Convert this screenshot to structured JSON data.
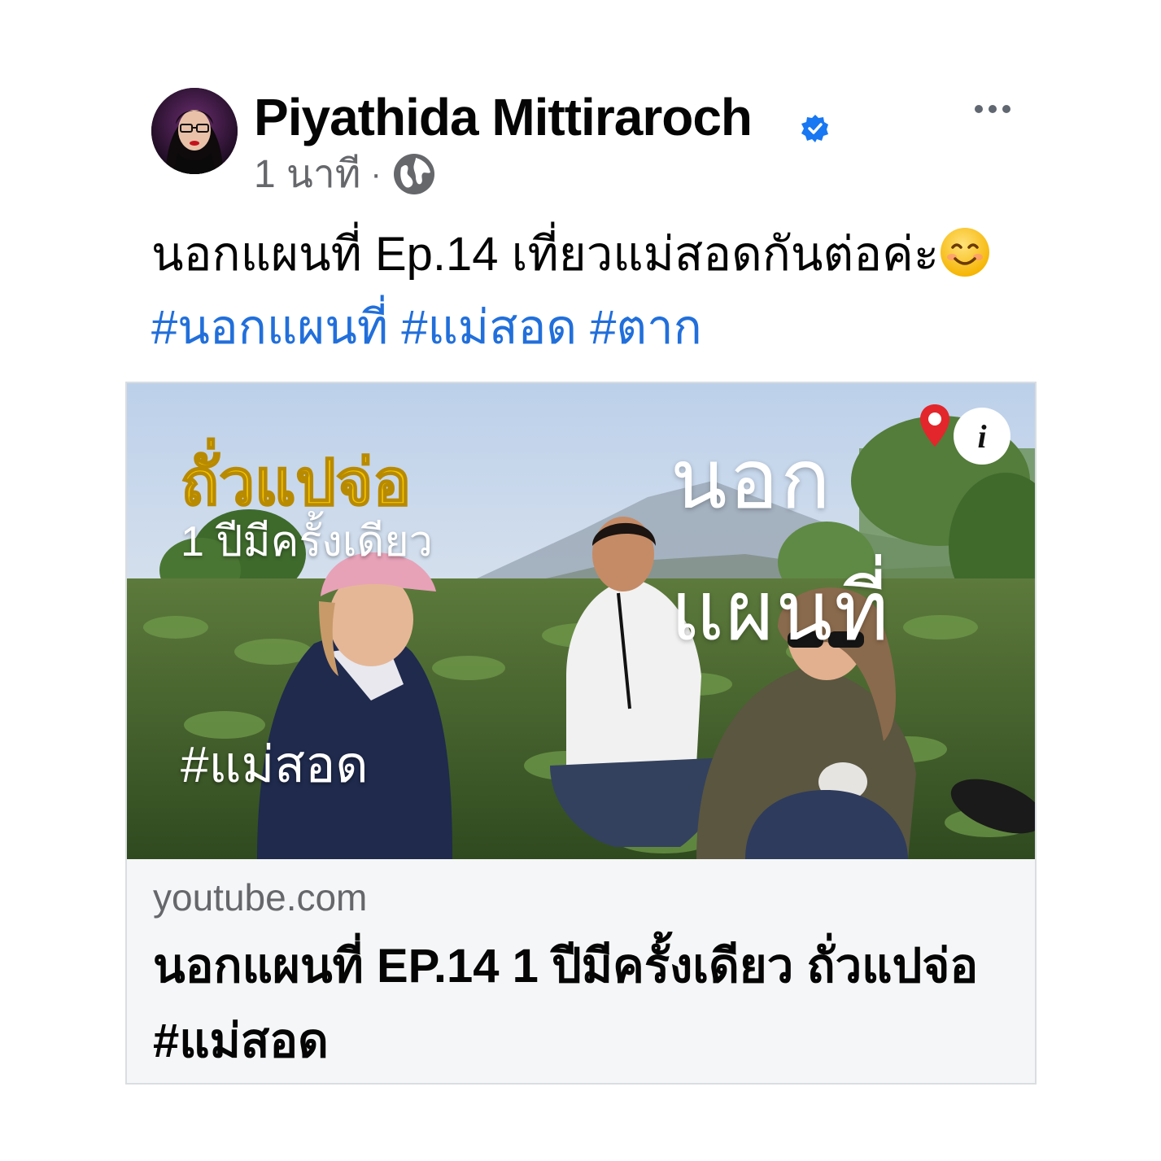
{
  "post": {
    "author": "Piyathida Mittiraroch",
    "time": "1 นาที",
    "separator": "·",
    "text": "นอกแผนที่ Ep.14 เที่ยวแม่สอดกันต่อค่ะ",
    "hashtags": [
      "#นอกแผนที่",
      "#แม่สอด",
      "#ตาก"
    ]
  },
  "link_card": {
    "domain": "youtube.com",
    "title": "นอกแผนที่ EP.14 1 ปีมีครั้งเดียว ถั่วแปจ่อ #แม่สอด",
    "thumbnail": {
      "title": "ถั่วแปจ่อ",
      "subtitle": "1 ปีมีครั้งเดียว",
      "tag": "#แม่สอด",
      "logo": "นอกแผนที่",
      "info": "i"
    }
  },
  "icons": {
    "verified": "verified-badge-icon",
    "privacy": "globe-icon",
    "more": "more-options-icon"
  },
  "colors": {
    "hashtag": "#216fdb",
    "verified": "#1877f2",
    "meta": "#65676b",
    "overlay_title": "#f5c400"
  }
}
